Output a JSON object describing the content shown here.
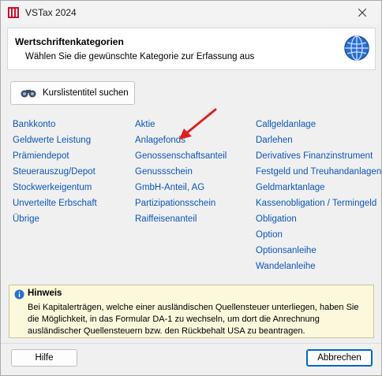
{
  "window": {
    "title": "VSTax 2024"
  },
  "header": {
    "title": "Wertschriftenkategorien",
    "subtitle": "Wählen Sie die gewünschte Kategorie zur Erfassung aus"
  },
  "search_button": {
    "label": "Kurslistentitel suchen"
  },
  "categories": {
    "col1": [
      "Bankkonto",
      "Geldwerte Leistung",
      "Prämiendepot",
      "Steuerauszug/Depot",
      "Stockwerkeigentum",
      "Unverteilte Erbschaft",
      "Übrige"
    ],
    "col2": [
      "Aktie",
      "Anlagefonds",
      "Genossenschaftsanteil",
      "Genussschein",
      "GmbH-Anteil, AG",
      "Partizipationsschein",
      "Raiffeisenanteil"
    ],
    "col3": [
      "Callgeldanlage",
      "Darlehen",
      "Derivatives Finanzinstrument",
      "Festgeld und Treuhandanlagen",
      "Geldmarktanlage",
      "Kassenobligation / Termingeld",
      "Obligation",
      "Option",
      "Optionsanleihe",
      "Wandelanleihe"
    ]
  },
  "hint": {
    "title": "Hinweis",
    "text": "Bei Kapitalerträgen, welche einer ausländischen Quellensteuer unterliegen, haben Sie die Möglichkeit, in das Formular DA-1 zu wechseln, um dort die Anrechnung ausländischer Quellensteuern bzw. den Rückbehalt USA zu beantragen."
  },
  "footer": {
    "help_label": "Hilfe",
    "cancel_label": "Abbrechen"
  },
  "colors": {
    "link": "#0b56b5",
    "hint_bg": "#fbf8dc",
    "arrow": "#e02020"
  }
}
